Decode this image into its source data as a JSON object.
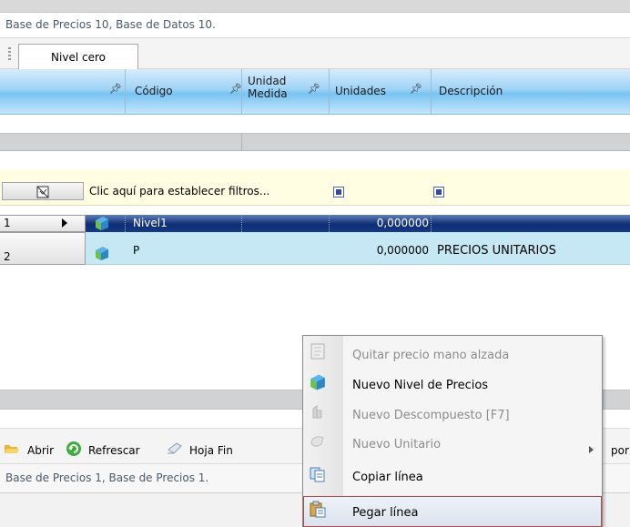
{
  "top_window": {
    "title": "Base de Precios 10, Base de Datos 10.",
    "tab": "Nivel cero"
  },
  "grid": {
    "columns": [
      {
        "label": ""
      },
      {
        "label": "Código"
      },
      {
        "label": "Unidad Medida",
        "label_line1": "Unidad",
        "label_line2": "Medida"
      },
      {
        "label": "Unidades"
      },
      {
        "label": "Descripción"
      }
    ],
    "filter_text": "Clic aquí para establecer filtros...",
    "rows": [
      {
        "num": "1",
        "code": "Nivel1",
        "unit": "",
        "units": "0,000000",
        "desc": "",
        "selected": true
      },
      {
        "num": "2",
        "code": "P",
        "unit": "",
        "units": "0,000000",
        "desc": "PRECIOS UNITARIOS",
        "selected": false
      }
    ]
  },
  "lower_toolbar": {
    "open": "Abrir",
    "refresh": "Refrescar",
    "sheet": "Hoja Fin",
    "truncated_right": "por"
  },
  "lower_window": {
    "title": "Base de Precios 1, Base de Precios 1."
  },
  "context_menu": {
    "items": [
      {
        "label": "Quitar precio mano alzada",
        "enabled": false,
        "icon": "remove-price-icon"
      },
      {
        "label": "Nuevo Nivel de Precios",
        "enabled": true,
        "icon": "new-level-icon"
      },
      {
        "label": "Nuevo Descompuesto [F7]",
        "enabled": false,
        "icon": "new-decomposed-icon"
      },
      {
        "label": "Nuevo Unitario",
        "enabled": false,
        "icon": "new-unit-icon",
        "has_submenu": true
      },
      {
        "label": "Copiar línea",
        "enabled": true,
        "icon": "copy-icon"
      },
      {
        "label": "Pegar línea",
        "enabled": true,
        "icon": "paste-icon",
        "highlighted": true
      }
    ]
  },
  "colors": {
    "selected_row": "#0e2c73",
    "row_bg": "#c6e8f4",
    "filter_bg": "#fffde2",
    "header_blue": "#78c2f2",
    "menu_highlight_border": "#b74852"
  }
}
